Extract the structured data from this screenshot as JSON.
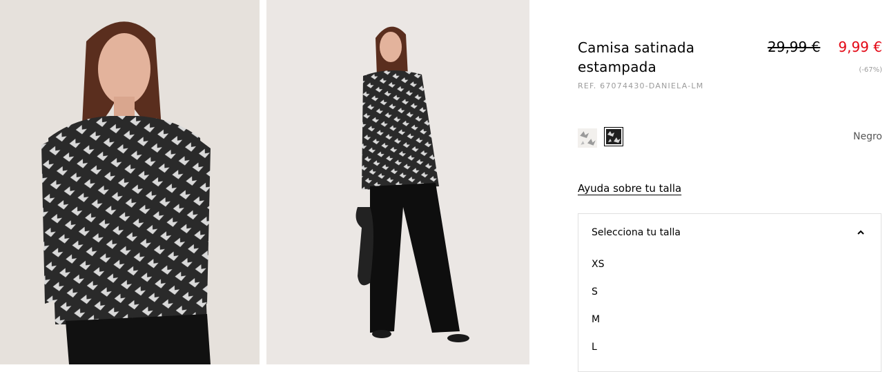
{
  "product": {
    "title": "Camisa satinada estampada",
    "ref": "REF. 67074430-DANIELA-LM",
    "old_price": "29,99 €",
    "new_price": "9,99 €",
    "discount": "(-67%)",
    "selected_color": "Negro"
  },
  "size_helper": {
    "label": "Ayuda sobre tu talla"
  },
  "size_select": {
    "placeholder": "Selecciona tu talla",
    "options": [
      "XS",
      "S",
      "M",
      "L"
    ]
  },
  "colors": {
    "price_sale": "#e30613",
    "muted": "#9b9b9b"
  }
}
